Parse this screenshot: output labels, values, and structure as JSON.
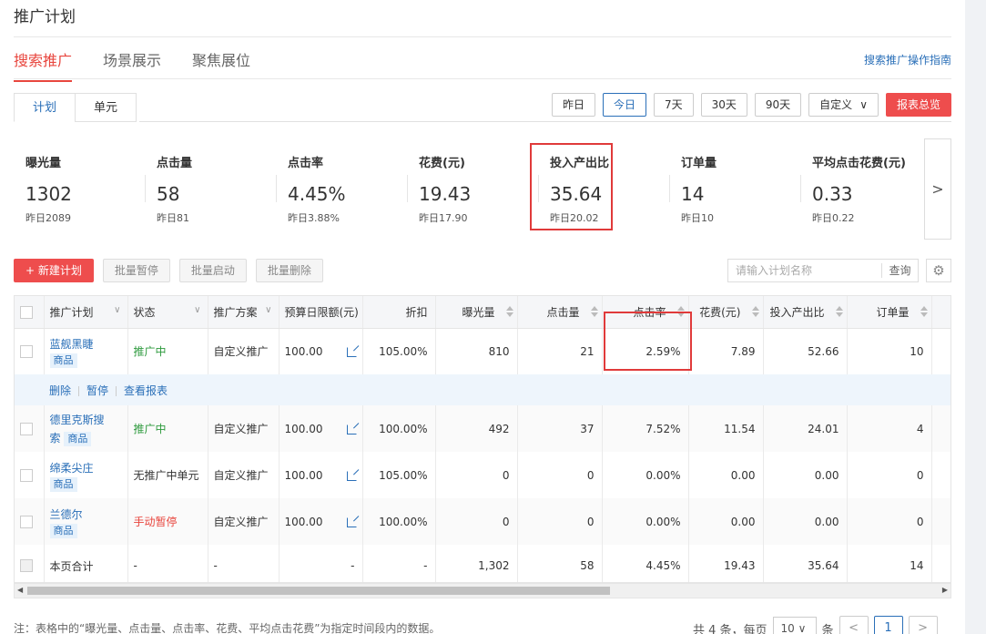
{
  "page_title": "推广计划",
  "main_tabs": [
    "搜索推广",
    "场景展示",
    "聚焦展位"
  ],
  "guide_link": "搜索推广操作指南",
  "sub_tabs": [
    "计划",
    "单元"
  ],
  "date_buttons": [
    "昨日",
    "今日",
    "7天",
    "30天",
    "90天"
  ],
  "custom_label": "自定义",
  "report_label": "报表总览",
  "metrics": [
    {
      "label": "曝光量",
      "value": "1302",
      "prev": "昨日2089"
    },
    {
      "label": "点击量",
      "value": "58",
      "prev": "昨日81"
    },
    {
      "label": "点击率",
      "value": "4.45%",
      "prev": "昨日3.88%"
    },
    {
      "label": "花费(元)",
      "value": "19.43",
      "prev": "昨日17.90"
    },
    {
      "label": "投入产出比",
      "value": "35.64",
      "prev": "昨日20.02"
    },
    {
      "label": "订单量",
      "value": "14",
      "prev": "昨日10"
    },
    {
      "label": "平均点击花费(元)",
      "value": "0.33",
      "prev": "昨日0.22"
    }
  ],
  "actions": {
    "new_plan": "+ 新建计划",
    "batch_pause": "批量暂停",
    "batch_start": "批量启动",
    "batch_delete": "批量删除"
  },
  "search": {
    "placeholder": "请输入计划名称",
    "button": "查询"
  },
  "table": {
    "headers": [
      "推广计划",
      "状态",
      "推广方案",
      "预算日限额(元)",
      "折扣",
      "曝光量",
      "点击量",
      "点击率",
      "花费(元)",
      "投入产出比",
      "订单量"
    ],
    "row_ops": [
      "删除",
      "暂停",
      "查看报表"
    ],
    "rows": [
      {
        "name": "蓝舰黑睫",
        "tag": "商品",
        "status": "推广中",
        "scheme": "自定义推广",
        "budget": "100.00",
        "discount": "105.00%",
        "impressions": "810",
        "clicks": "21",
        "ctr": "2.59%",
        "cost": "7.89",
        "roi": "52.66",
        "orders": "10"
      },
      {
        "name": "德里克斯搜索",
        "tag": "商品",
        "status": "推广中",
        "scheme": "自定义推广",
        "budget": "100.00",
        "discount": "100.00%",
        "impressions": "492",
        "clicks": "37",
        "ctr": "7.52%",
        "cost": "11.54",
        "roi": "24.01",
        "orders": "4"
      },
      {
        "name": "绵柔尖庄",
        "tag": "商品",
        "status": "无推广中单元",
        "scheme": "自定义推广",
        "budget": "100.00",
        "discount": "105.00%",
        "impressions": "0",
        "clicks": "0",
        "ctr": "0.00%",
        "cost": "0.00",
        "roi": "0.00",
        "orders": "0"
      },
      {
        "name": "兰德尔",
        "tag": "商品",
        "status": "手动暂停",
        "scheme": "自定义推广",
        "budget": "100.00",
        "discount": "100.00%",
        "impressions": "0",
        "clicks": "0",
        "ctr": "0.00%",
        "cost": "0.00",
        "roi": "0.00",
        "orders": "0"
      }
    ],
    "total": {
      "label": "本页合计",
      "status": "-",
      "scheme": "-",
      "budget": "-",
      "discount": "-",
      "impressions": "1,302",
      "clicks": "58",
      "ctr": "4.45%",
      "cost": "19.43",
      "roi": "35.64",
      "orders": "14"
    }
  },
  "note": "注：表格中的“曝光量、点击量、点击率、花费、平均点击花费”为指定时间段内的数据。",
  "pager": {
    "total": "共 4 条，每页",
    "page_size": "10",
    "unit": "条",
    "current": "1"
  },
  "colors": {
    "accent": "#e8463e",
    "link": "#2a6fb8",
    "success": "#2e9a3e"
  }
}
